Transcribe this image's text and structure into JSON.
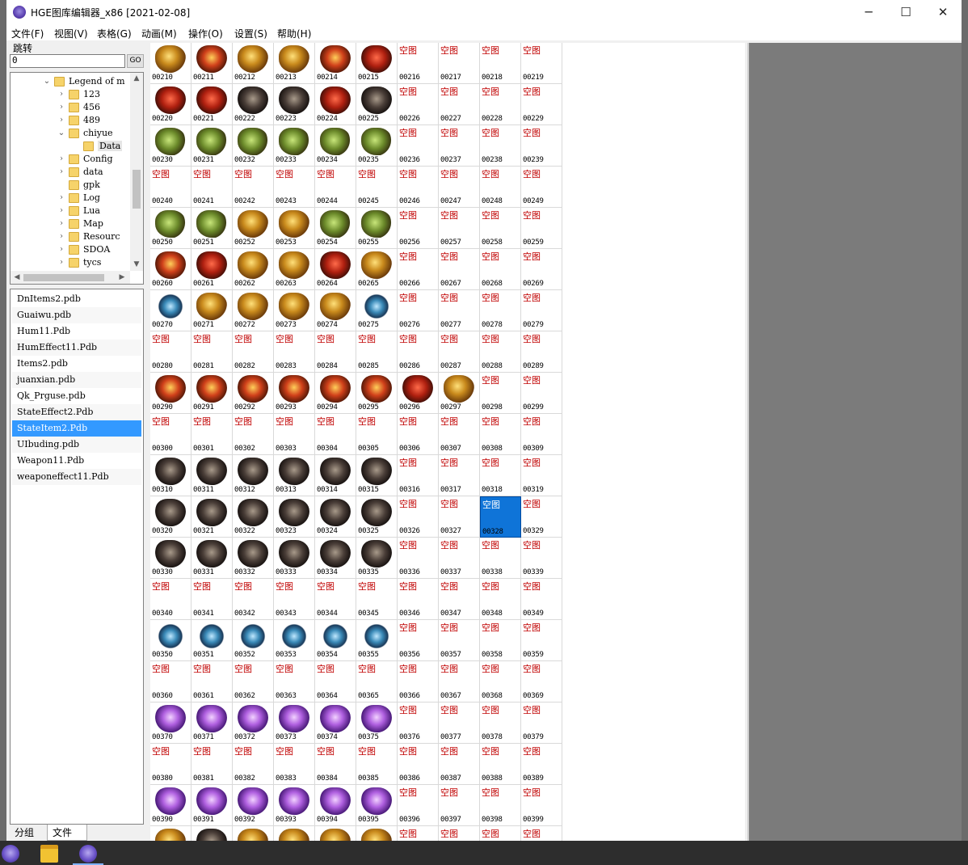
{
  "window": {
    "title": "HGE图库编辑器_x86 [2021-02-08]",
    "min_icon": "─",
    "max_icon": "☐",
    "close_icon": "✕"
  },
  "menu": [
    "文件(F)",
    "视图(V)",
    "表格(G)",
    "动画(M)",
    "操作(O)",
    "设置(S)",
    "帮助(H)"
  ],
  "jump": {
    "label": "跳转",
    "value": "0",
    "go_label": "GO"
  },
  "tree": {
    "nodes": [
      {
        "label": "Legend of m",
        "depth": 0,
        "arrow": "expanded"
      },
      {
        "label": "123",
        "depth": 1,
        "arrow": "collapsed"
      },
      {
        "label": "456",
        "depth": 1,
        "arrow": "collapsed"
      },
      {
        "label": "489",
        "depth": 1,
        "arrow": "collapsed"
      },
      {
        "label": "chiyue",
        "depth": 1,
        "arrow": "expanded"
      },
      {
        "label": "Data",
        "depth": 2,
        "arrow": "none"
      },
      {
        "label": "Config",
        "depth": 1,
        "arrow": "collapsed"
      },
      {
        "label": "data",
        "depth": 1,
        "arrow": "collapsed"
      },
      {
        "label": "gpk",
        "depth": 1,
        "arrow": "none"
      },
      {
        "label": "Log",
        "depth": 1,
        "arrow": "collapsed"
      },
      {
        "label": "Lua",
        "depth": 1,
        "arrow": "collapsed"
      },
      {
        "label": "Map",
        "depth": 1,
        "arrow": "collapsed"
      },
      {
        "label": "Resourc",
        "depth": 1,
        "arrow": "collapsed"
      },
      {
        "label": "SDOA",
        "depth": 1,
        "arrow": "collapsed"
      },
      {
        "label": "tycs",
        "depth": 1,
        "arrow": "collapsed"
      }
    ]
  },
  "files": {
    "items": [
      "DnItems2.pdb",
      "Guaiwu.pdb",
      "Hum11.Pdb",
      "HumEffect11.Pdb",
      "Items2.pdb",
      "juanxian.pdb",
      "Qk_Prguse.pdb",
      "StateEffect2.Pdb",
      "StateItem2.Pdb",
      "UIbuding.pdb",
      "Weapon11.Pdb",
      "weaponeffect11.Pdb"
    ],
    "selected": "StateItem2.Pdb"
  },
  "tabs": {
    "group": "分组",
    "file": "文件"
  },
  "grid": {
    "empty_label": "空图",
    "start_index": 210,
    "columns": 10,
    "selected_index": 328,
    "rows": [
      [
        "gold",
        "redgold",
        "gold",
        "gold",
        "redgold",
        "red",
        "",
        "",
        "",
        ""
      ],
      [
        "red",
        "red",
        "dark",
        "dark",
        "red",
        "dark",
        "",
        "",
        "",
        ""
      ],
      [
        "green",
        "green",
        "green",
        "green",
        "green",
        "green",
        "",
        "",
        "",
        ""
      ],
      [
        "",
        "",
        "",
        "",
        "",
        "",
        "",
        "",
        "",
        ""
      ],
      [
        "green",
        "green",
        "gold",
        "gold",
        "green",
        "green",
        "",
        "",
        "",
        ""
      ],
      [
        "redgold",
        "red",
        "gold",
        "gold",
        "red",
        "gold",
        "",
        "",
        "",
        ""
      ],
      [
        "blue",
        "gold",
        "gold",
        "gold",
        "gold",
        "blue",
        "",
        "",
        "",
        ""
      ],
      [
        "",
        "",
        "",
        "",
        "",
        "",
        "",
        "",
        "",
        ""
      ],
      [
        "redgold",
        "redgold",
        "redgold",
        "redgold",
        "redgold",
        "redgold",
        "red",
        "gold",
        "",
        ""
      ],
      [
        "",
        "",
        "",
        "",
        "",
        "",
        "",
        "",
        "",
        ""
      ],
      [
        "dark",
        "dark",
        "dark",
        "dark",
        "dark",
        "dark",
        "",
        "",
        "",
        ""
      ],
      [
        "dark",
        "dark",
        "dark",
        "dark",
        "dark",
        "dark",
        "",
        "",
        "",
        ""
      ],
      [
        "dark",
        "dark",
        "dark",
        "dark",
        "dark",
        "dark",
        "",
        "",
        "",
        ""
      ],
      [
        "",
        "",
        "",
        "",
        "",
        "",
        "",
        "",
        "",
        ""
      ],
      [
        "blue",
        "blue",
        "blue",
        "blue",
        "blue",
        "blue",
        "",
        "",
        "",
        ""
      ],
      [
        "",
        "",
        "",
        "",
        "",
        "",
        "",
        "",
        "",
        ""
      ],
      [
        "purple",
        "purple",
        "purple",
        "purple",
        "purple",
        "purple",
        "",
        "",
        "",
        ""
      ],
      [
        "",
        "",
        "",
        "",
        "",
        "",
        "",
        "",
        "",
        ""
      ],
      [
        "purple",
        "purple",
        "purple",
        "purple",
        "purple",
        "purple",
        "",
        "",
        "",
        ""
      ],
      [
        "gold",
        "dark",
        "gold",
        "gold",
        "gold",
        "gold",
        "",
        "",
        "",
        ""
      ]
    ]
  },
  "colors": {
    "selection": "#3399ff",
    "empty_text": "#c00000",
    "preview_bg": "#7b7b7b"
  },
  "icons": {
    "up": "▲",
    "down": "▼",
    "left": "◀",
    "right": "▶",
    "expanded": "⌄",
    "collapsed": "›"
  }
}
